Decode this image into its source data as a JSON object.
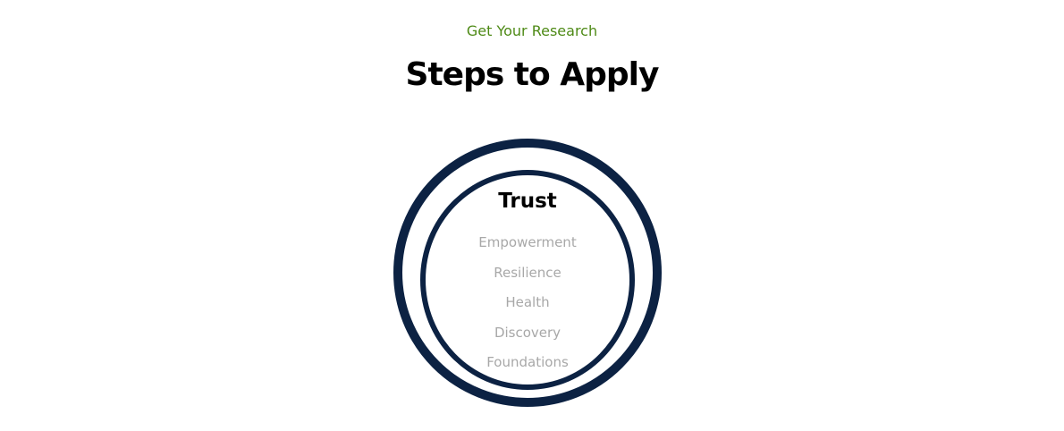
{
  "header": {
    "eyebrow": "Get Your Research",
    "title": "Steps to Apply"
  },
  "rings": {
    "center_title": "Trust",
    "items": [
      "Empowerment",
      "Resilience",
      "Health",
      "Discovery",
      "Foundations"
    ]
  },
  "colors": {
    "accent_green": "#4e8a16",
    "ring_navy": "#0c2243",
    "item_gray": "#a8a8a8"
  }
}
